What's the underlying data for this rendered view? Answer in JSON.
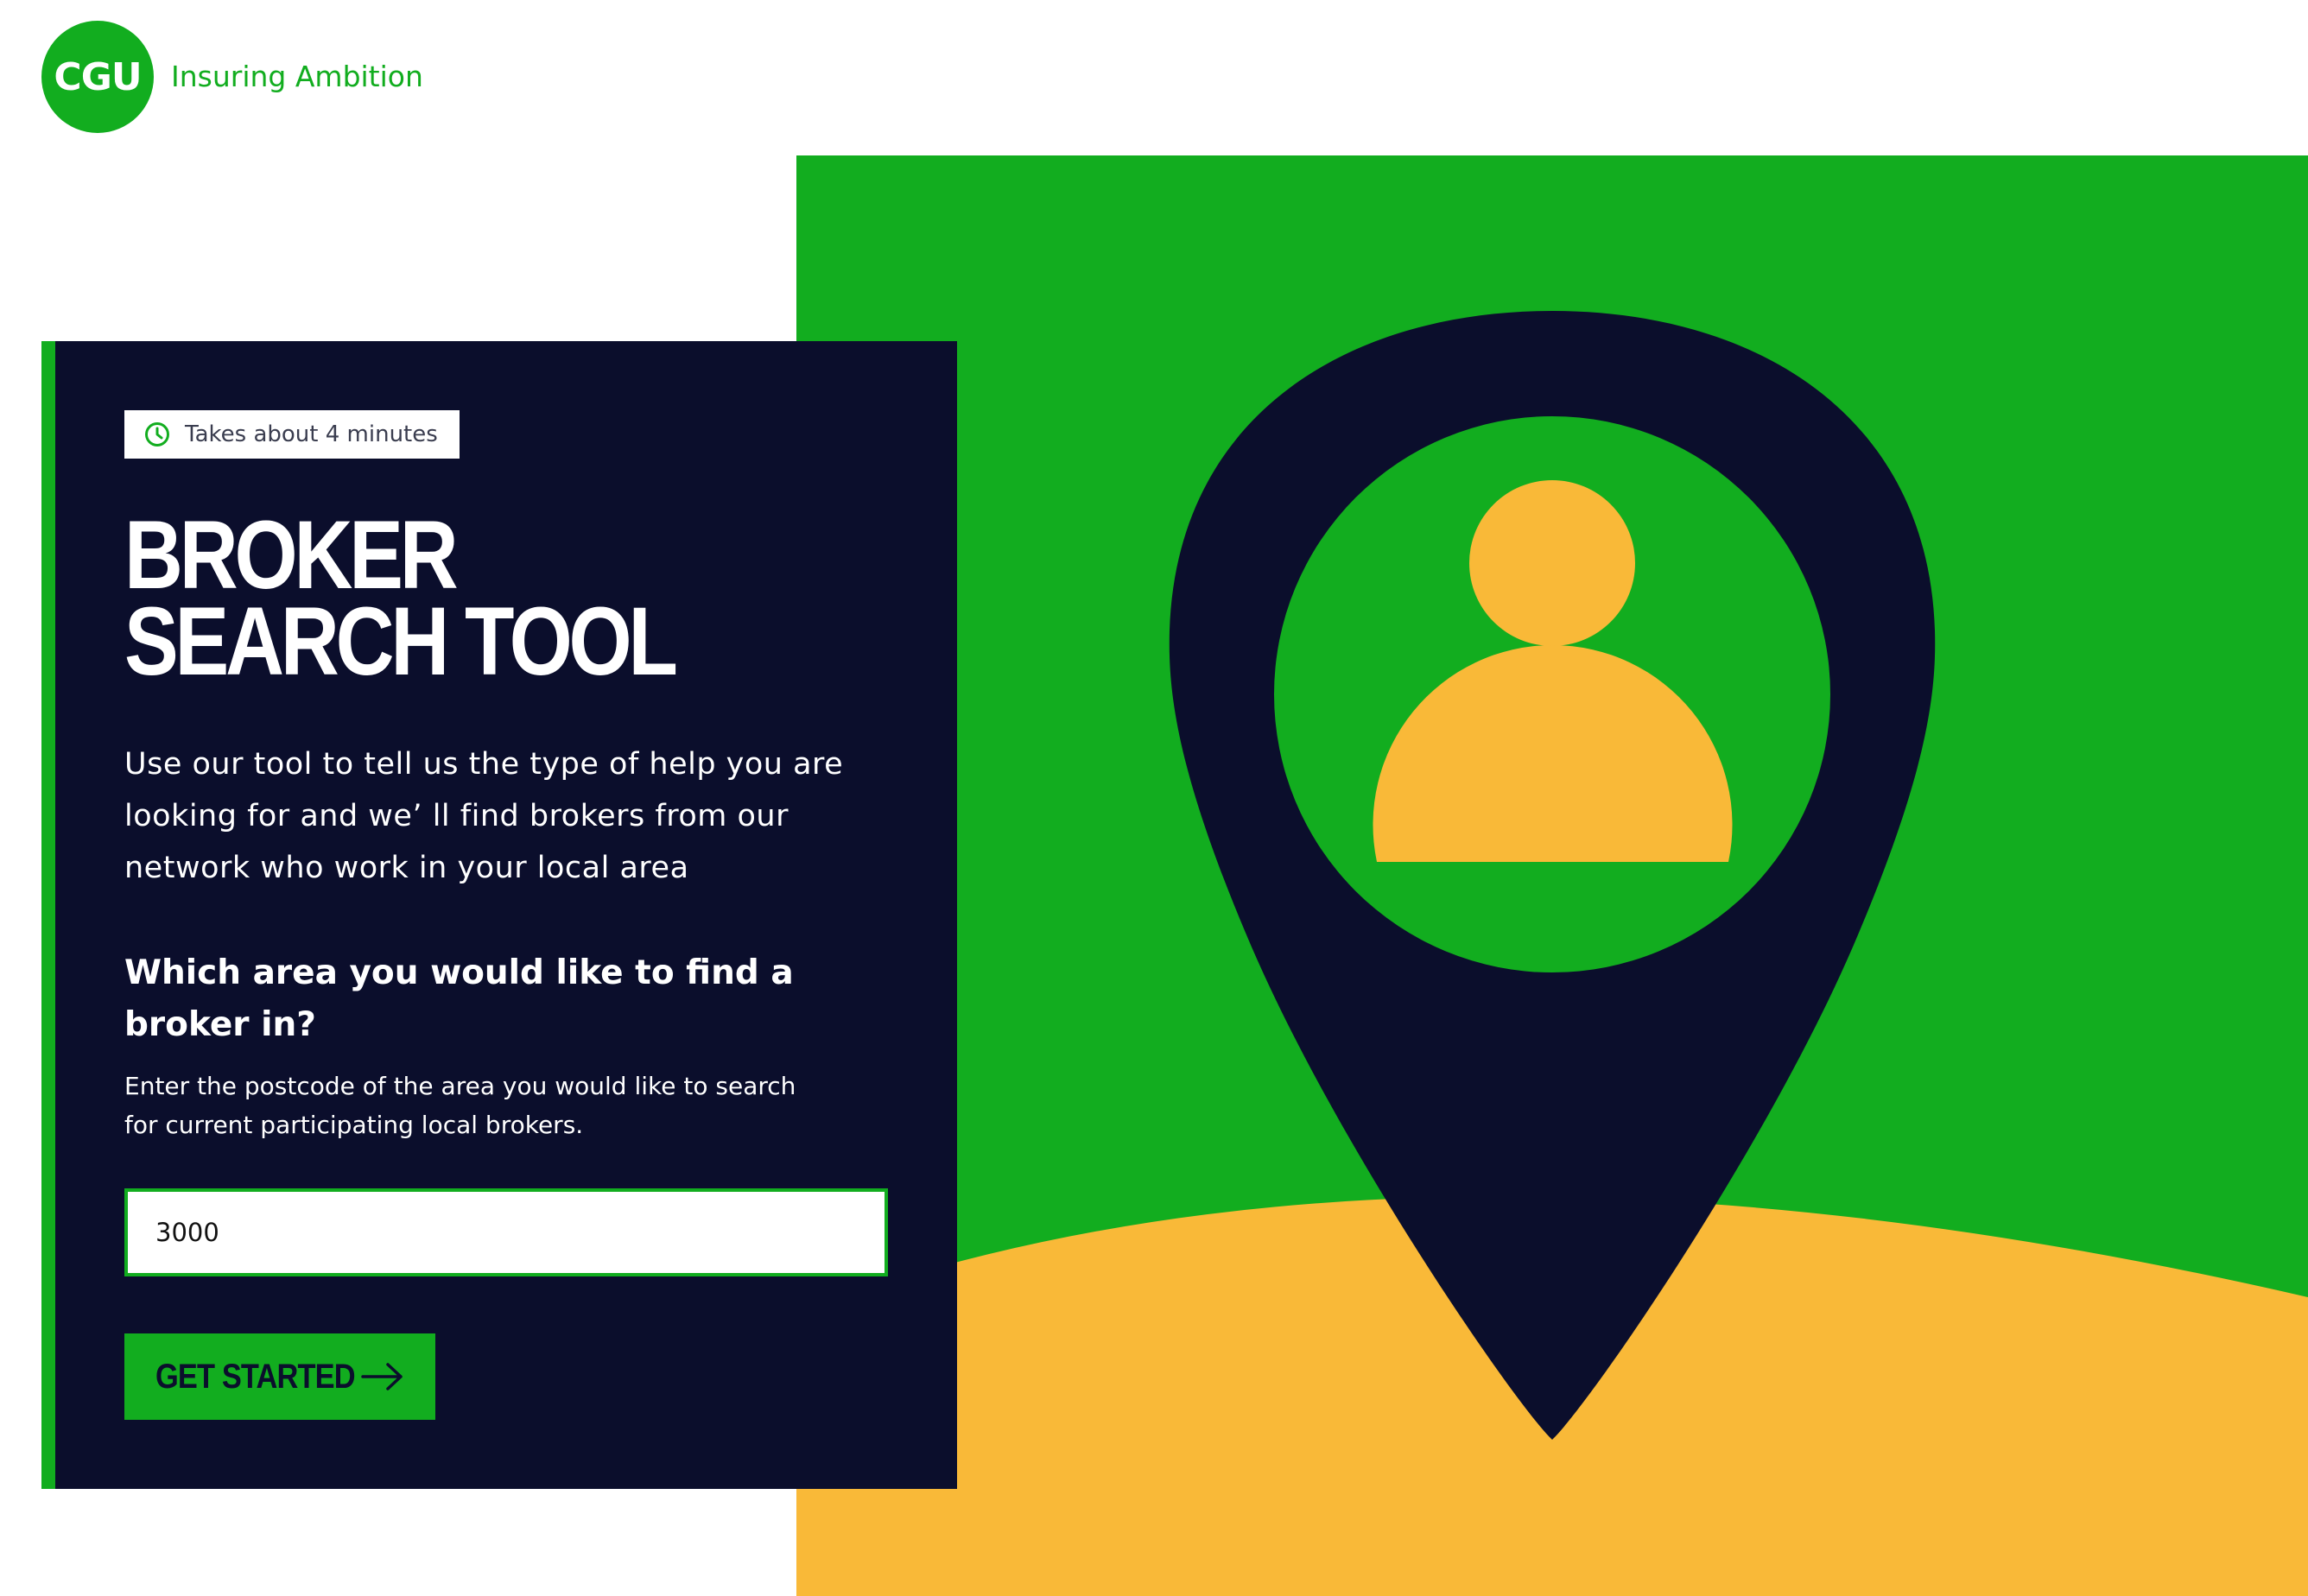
{
  "header": {
    "logo_text": "CGU",
    "tagline": "Insuring Ambition"
  },
  "card": {
    "time_badge": "Takes about 4 minutes",
    "title_line1": "BROKER",
    "title_line2": "SEARCH TOOL",
    "intro": "Use our tool to tell us the type of help you are looking for and we’ ll find brokers from our network who work in your local area",
    "question": "Which area you would like to find a broker in?",
    "helper": "Enter the postcode of the area you would like to search for current participating local brokers.",
    "postcode_input": {
      "value": "3000"
    },
    "cta_label": "GET STARTED"
  },
  "icons": {
    "badge": "clock-icon",
    "cta": "arrow-right-icon",
    "hero": "location-pin-person-illustration"
  },
  "colors": {
    "brand_green": "#12ad1f",
    "navy": "#0b0e2c",
    "yellow": "#f9b938",
    "white": "#ffffff"
  }
}
